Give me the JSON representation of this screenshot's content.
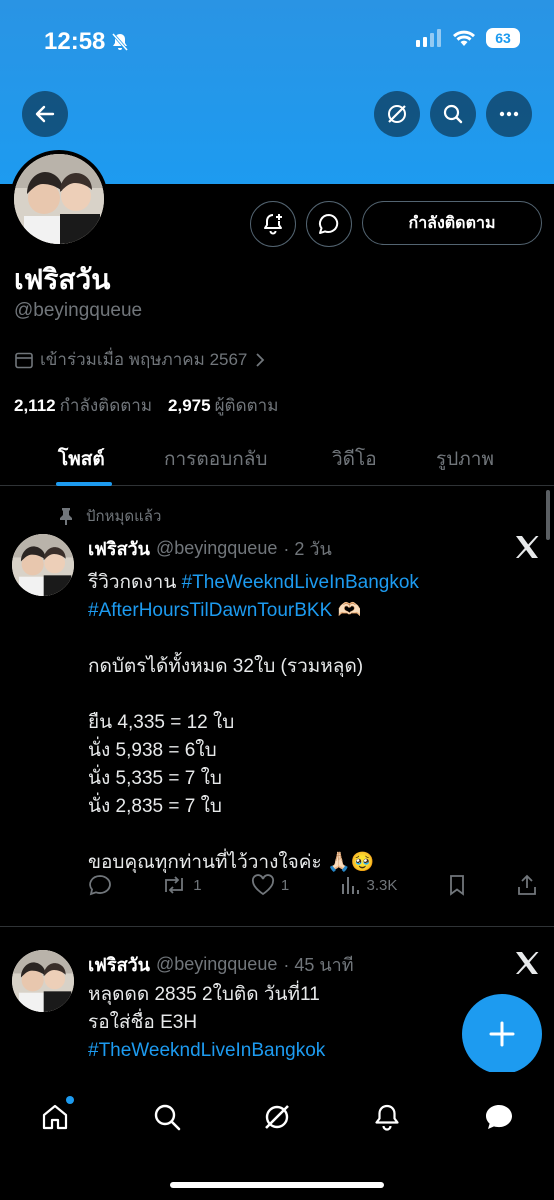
{
  "status_bar": {
    "time": "12:58",
    "battery": "63"
  },
  "profile": {
    "display_name": "เฟริสวัน",
    "handle": "@beyingqueue",
    "joined": "เข้าร่วมเมื่อ พฤษภาคม 2567",
    "following_count": "2,112",
    "following_label": "กำลังติดตาม",
    "followers_count": "2,975",
    "followers_label": "ผู้ติดตาม",
    "follow_button": "กำลังติดตาม"
  },
  "tabs": [
    {
      "label": "โพสต์"
    },
    {
      "label": "การตอบกลับ"
    },
    {
      "label": "วิดีโอ"
    },
    {
      "label": "รูปภาพ"
    }
  ],
  "posts": [
    {
      "pinned_label": "ปักหมุดแล้ว",
      "name": "เฟริสวัน",
      "handle": "@beyingqueue",
      "time": "· 2 วัน",
      "line1": "รีวิวกดงาน ",
      "hashtag1": "#TheWeekndLiveInBangkok",
      "hashtag2": "#AfterHoursTilDawnTourBKK",
      "emoji1": " 🫶🏻",
      "line2": "กดบัตรได้ทั้งหมด 32ใบ (รวมหลุด)",
      "line3": "ยืน 4,335 = 12 ใบ",
      "line4": "นั่ง 5,938 = 6ใบ",
      "line5": "นั่ง 5,335 = 7 ใบ",
      "line6": "นั่ง 2,835 = 7 ใบ",
      "line7": "ขอบคุณทุกท่านที่ไว้วางใจค่ะ 🙏🏻🥹",
      "reposts": "1",
      "likes": "1",
      "views": "3.3K"
    },
    {
      "name": "เฟริสวัน",
      "handle": "@beyingqueue",
      "time": "· 45 นาที",
      "line1": "หลุดดด 2835 2ใบติด วันที่11",
      "line2": "รอใส่ชื่อ E3H",
      "hashtag1": "#TheWeekndLiveInBangkok"
    }
  ],
  "colors": {
    "accent": "#1d9bf0",
    "background": "#000000",
    "muted": "#71767b"
  },
  "icons": [
    "back-arrow-icon",
    "grok-icon",
    "search-icon",
    "more-icon",
    "bell-plus-icon",
    "message-icon",
    "calendar-icon",
    "pin-icon",
    "x-logo-icon",
    "reply-icon",
    "repost-icon",
    "like-icon",
    "views-icon",
    "bookmark-icon",
    "share-icon",
    "plus-icon",
    "home-icon",
    "explore-icon",
    "notifications-icon",
    "messages-icon"
  ]
}
